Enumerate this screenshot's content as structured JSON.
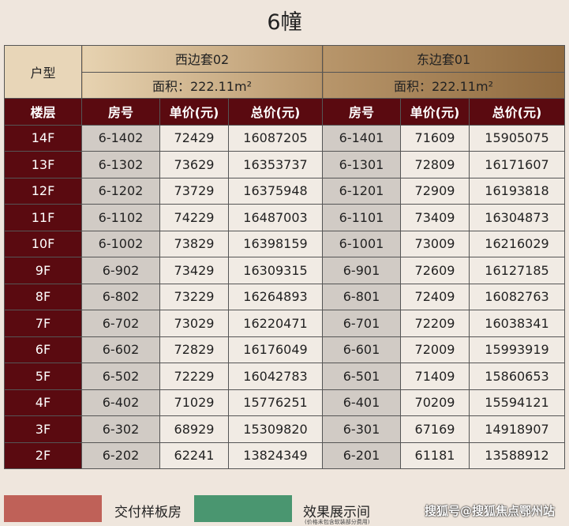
{
  "title": "6幢",
  "header": {
    "type_label": "户型",
    "west": {
      "name": "西边套02",
      "area": "面积：222.11m²"
    },
    "east": {
      "name": "东边套01",
      "area": "面积：222.11m²"
    }
  },
  "columns": [
    "楼层",
    "房号",
    "单价(元)",
    "总价(元)",
    "房号",
    "单价(元)",
    "总价(元)"
  ],
  "rows": [
    [
      "14F",
      "6-1402",
      "72429",
      "16087205",
      "6-1401",
      "71609",
      "15905075"
    ],
    [
      "13F",
      "6-1302",
      "73629",
      "16353737",
      "6-1301",
      "72809",
      "16171607"
    ],
    [
      "12F",
      "6-1202",
      "73729",
      "16375948",
      "6-1201",
      "72909",
      "16193818"
    ],
    [
      "11F",
      "6-1102",
      "74229",
      "16487003",
      "6-1101",
      "73409",
      "16304873"
    ],
    [
      "10F",
      "6-1002",
      "73829",
      "16398159",
      "6-1001",
      "73009",
      "16216029"
    ],
    [
      "9F",
      "6-902",
      "73429",
      "16309315",
      "6-901",
      "72609",
      "16127185"
    ],
    [
      "8F",
      "6-802",
      "73229",
      "16264893",
      "6-801",
      "72409",
      "16082763"
    ],
    [
      "7F",
      "6-702",
      "73029",
      "16220471",
      "6-701",
      "72209",
      "16038341"
    ],
    [
      "6F",
      "6-602",
      "72829",
      "16176049",
      "6-601",
      "72009",
      "15993919"
    ],
    [
      "5F",
      "6-502",
      "72229",
      "16042783",
      "6-501",
      "71409",
      "15860653"
    ],
    [
      "4F",
      "6-402",
      "71029",
      "15776251",
      "6-401",
      "70209",
      "15594121"
    ],
    [
      "3F",
      "6-302",
      "68929",
      "15309820",
      "6-301",
      "67169",
      "14918907"
    ],
    [
      "2F",
      "6-202",
      "62241",
      "13824349",
      "6-201",
      "61181",
      "13588912"
    ]
  ],
  "legend": {
    "red_label": "交付样板房",
    "red_color": "#bf6158",
    "green_label": "效果展示间",
    "green_color": "#4a9670",
    "note": "(价格未包含软装部分费用)"
  },
  "watermark": "搜狐号@搜狐焦点鄂州站"
}
